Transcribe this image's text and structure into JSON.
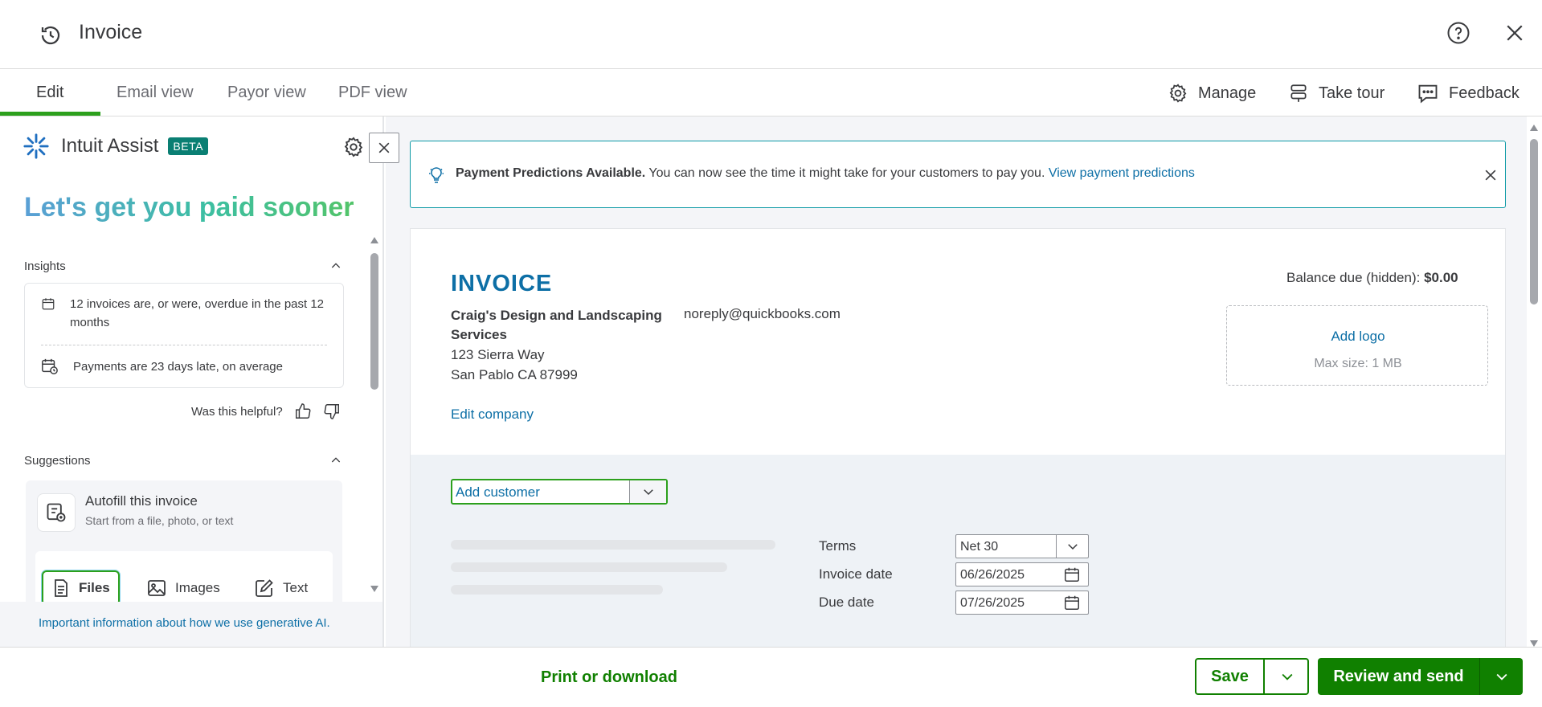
{
  "header": {
    "title": "Invoice"
  },
  "tabs": [
    {
      "label": "Edit",
      "active": true
    },
    {
      "label": "Email view"
    },
    {
      "label": "Payor view"
    },
    {
      "label": "PDF view"
    }
  ],
  "toolbar": {
    "manage": "Manage",
    "take_tour": "Take tour",
    "feedback": "Feedback"
  },
  "assist": {
    "title": "Intuit Assist",
    "badge": "BETA",
    "headline": "Let's get you paid sooner",
    "insights_label": "Insights",
    "insights": [
      "12 invoices are, or were, overdue in the past 12 months",
      "Payments are 23 days late, on average"
    ],
    "helpful_prompt": "Was this helpful?",
    "suggestions_label": "Suggestions",
    "autofill": {
      "title": "Autofill this invoice",
      "subtitle": "Start from a file, photo, or text"
    },
    "sources": [
      "Files",
      "Images",
      "Text"
    ],
    "genai_link": "Important information about how we use generative AI."
  },
  "banner": {
    "bold": "Payment Predictions Available.",
    "text": "You can now see the time it might take for your customers to pay you.",
    "link": "View payment predictions"
  },
  "invoice": {
    "title": "INVOICE",
    "company_name": "Craig's Design and Landscaping Services",
    "company_email": "noreply@quickbooks.com",
    "address_line1": "123 Sierra Way",
    "address_line2": "San Pablo CA 87999",
    "edit_company": "Edit company",
    "balance_label": "Balance due (hidden):",
    "balance_value": "$0.00",
    "logo_add": "Add logo",
    "logo_max": "Max size: 1 MB",
    "customer_placeholder": "Add customer",
    "terms_label": "Terms",
    "terms_value": "Net 30",
    "invoice_date_label": "Invoice date",
    "invoice_date_value": "06/26/2025",
    "due_date_label": "Due date",
    "due_date_value": "07/26/2025"
  },
  "footer": {
    "print": "Print or download",
    "save": "Save",
    "review_send": "Review and send"
  },
  "colors": {
    "accent_green": "#2ca01c",
    "button_green": "#108000",
    "link_blue": "#0d6fa6",
    "banner_border": "#0d9aa6"
  }
}
